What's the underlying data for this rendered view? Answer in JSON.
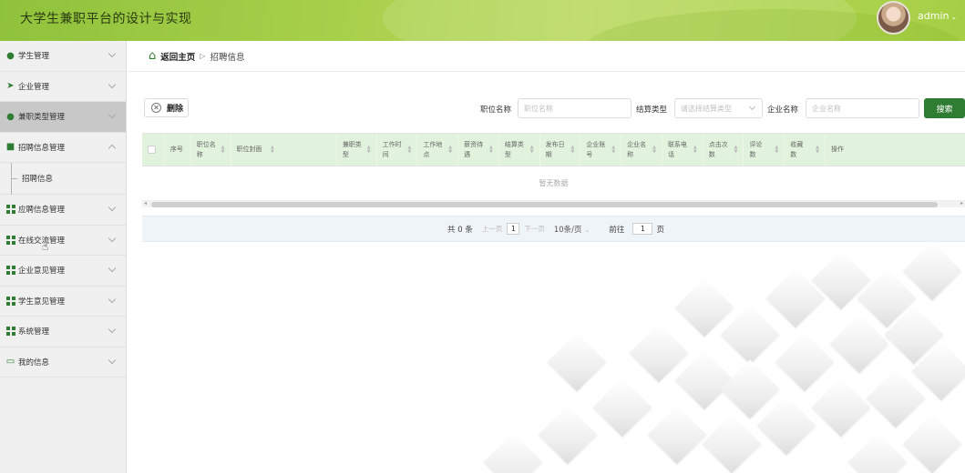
{
  "app": {
    "title": "大学生兼职平台的设计与实现",
    "user": "admin"
  },
  "colors": {
    "primary": "#2e7d32",
    "header_green": "#a6cf45",
    "table_header": "#e1f2dd"
  },
  "sidebar": {
    "items": [
      {
        "label": "学生管理",
        "icon": "leaf-icon"
      },
      {
        "label": "企业管理",
        "icon": "paper-plane-icon"
      },
      {
        "label": "兼职类型管理",
        "icon": "user-icon"
      },
      {
        "label": "招聘信息管理",
        "icon": "briefcase-icon"
      },
      {
        "label": "应聘信息管理",
        "icon": "grid-icon"
      },
      {
        "label": "在线交流管理",
        "icon": "grid-icon"
      },
      {
        "label": "企业意见管理",
        "icon": "grid-icon"
      },
      {
        "label": "学生意见管理",
        "icon": "grid-icon"
      },
      {
        "label": "系统管理",
        "icon": "grid-icon"
      },
      {
        "label": "我的信息",
        "icon": "wallet-icon"
      }
    ],
    "sub_item": "招聘信息"
  },
  "breadcrumb": {
    "home": "返回主页",
    "current": "招聘信息"
  },
  "toolbar": {
    "delete_label": "删除"
  },
  "filters": {
    "job_name_label": "职位名称",
    "job_name_placeholder": "职位名称",
    "settle_type_label": "结算类型",
    "settle_type_placeholder": "请选择结算类型",
    "company_name_label": "企业名称",
    "company_name_placeholder": "企业名称",
    "search_label": "搜索"
  },
  "table": {
    "columns": [
      {
        "label": "序号",
        "w": 0
      },
      {
        "label": "职位名称",
        "w": 0
      },
      {
        "label": "职位封面",
        "w": 0
      },
      {
        "label": "兼职类型",
        "w": 0
      },
      {
        "label": "工作时间",
        "w": 0
      },
      {
        "label": "工作地点",
        "w": 0
      },
      {
        "label": "薪资待遇",
        "w": 0
      },
      {
        "label": "结算类型",
        "w": 0
      },
      {
        "label": "发布日期",
        "w": 0
      },
      {
        "label": "企业账号",
        "w": 0
      },
      {
        "label": "企业名称",
        "w": 0
      },
      {
        "label": "联系电话",
        "w": 0
      },
      {
        "label": "点击次数",
        "w": 0
      },
      {
        "label": "评论数",
        "w": 0
      },
      {
        "label": "收藏数",
        "w": 0
      },
      {
        "label": "操作",
        "w": 0
      }
    ],
    "empty_text": "暂无数据"
  },
  "pagination": {
    "total": "共 0 条",
    "prev": "上一页",
    "page": "1",
    "next": "下一页",
    "page_size": "10条/页",
    "goto": "前往",
    "goto_value": "1",
    "page_unit": "页"
  }
}
